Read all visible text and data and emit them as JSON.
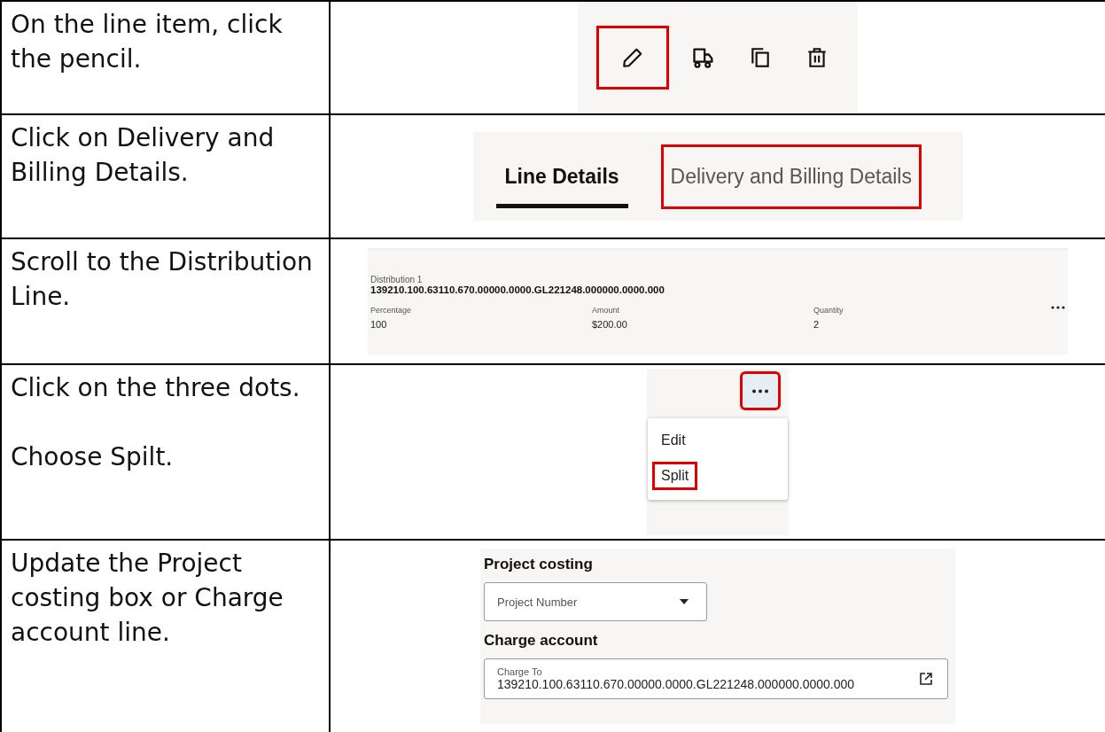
{
  "steps": [
    {
      "kind": "toolbar",
      "instruction": [
        "On the line item, click the pencil."
      ],
      "tools": [
        {
          "kind": "pencil",
          "highlighted": true
        },
        {
          "kind": "truck",
          "highlighted": false
        },
        {
          "kind": "copy",
          "highlighted": false
        },
        {
          "kind": "trash",
          "highlighted": false
        }
      ]
    },
    {
      "kind": "tabs",
      "instruction": [
        "Click on Delivery and Billing Details."
      ],
      "tabs": [
        {
          "label": "Line Details",
          "selected": true,
          "highlighted": false
        },
        {
          "label": "Delivery and Billing Details",
          "selected": false,
          "highlighted": true
        }
      ]
    },
    {
      "kind": "distribution",
      "instruction": [
        "Scroll to the Distribution Line."
      ],
      "caption": "Distribution 1",
      "account": "139210.100.63110.670.00000.0000.GL221248.000000.0000.000",
      "fields": [
        {
          "label": "Percentage",
          "value": "100"
        },
        {
          "label": "Amount",
          "value": "$200.00"
        },
        {
          "label": "Quantity",
          "value": "2"
        }
      ]
    },
    {
      "kind": "menu",
      "instruction": [
        "Click on the three dots.",
        "Choose Spilt."
      ],
      "button_highlighted": true,
      "items": [
        {
          "label": "Edit",
          "highlighted": false
        },
        {
          "label": "Split",
          "highlighted": true
        }
      ]
    },
    {
      "kind": "form",
      "instruction": [
        "Update the Project costing box or Charge account line."
      ],
      "project_heading": "Project costing",
      "project_placeholder": "Project Number",
      "charge_heading": "Charge account",
      "charge_label": "Charge To",
      "charge_value": "139210.100.63110.670.00000.0000.GL221248.000000.0000.000"
    }
  ]
}
